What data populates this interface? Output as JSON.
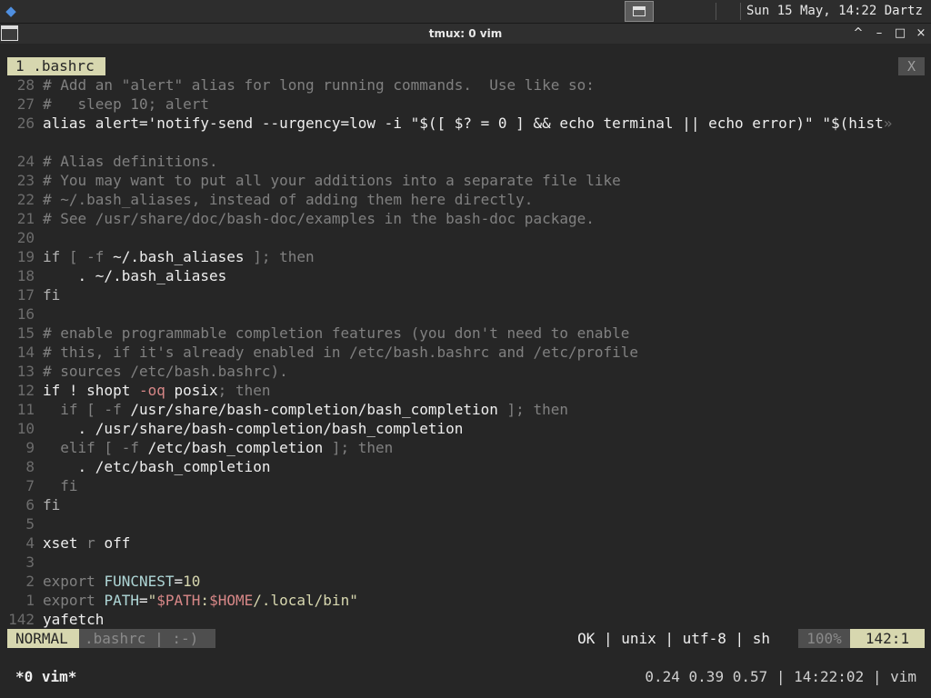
{
  "panel": {
    "menu_icon": "distro-menu-icon",
    "taskbar_icon": "window-icon",
    "clock": "Sun 15 May, 14:22",
    "user": "Dartz"
  },
  "window": {
    "title": "tmux: 0 vim",
    "minimize": "^",
    "maximize_restore": "–",
    "maximize": "□",
    "close": "×"
  },
  "vim": {
    "tab_label": "1 .bashrc",
    "tab_close": "X",
    "lines": [
      {
        "n": "28",
        "segments": [
          {
            "t": "# Add an \"alert\" alias for long running commands.  Use like so:",
            "c": "cm"
          }
        ]
      },
      {
        "n": "27",
        "segments": [
          {
            "t": "#   sleep 10; alert",
            "c": "cm"
          }
        ]
      },
      {
        "n": "26",
        "segments": [
          {
            "t": "alias alert=",
            "c": ""
          },
          {
            "t": "'notify-send --urgency=low -i \"$([ $? = 0 ] && echo terminal || echo error)\" \"$(hist",
            "c": ""
          },
          {
            "t": "»",
            "c": "ar"
          }
        ]
      },
      {
        "n": "",
        "segments": []
      },
      {
        "n": "24",
        "segments": [
          {
            "t": "# Alias definitions.",
            "c": "cm"
          }
        ]
      },
      {
        "n": "23",
        "segments": [
          {
            "t": "# You may want to put all your additions into a separate file like",
            "c": "cm"
          }
        ]
      },
      {
        "n": "22",
        "segments": [
          {
            "t": "# ~/.bash_aliases, instead of adding them here directly.",
            "c": "cm"
          }
        ]
      },
      {
        "n": "21",
        "segments": [
          {
            "t": "# See /usr/share/doc/bash-doc/examples in the bash-doc package.",
            "c": "cm"
          }
        ]
      },
      {
        "n": "20",
        "segments": []
      },
      {
        "n": "19",
        "segments": [
          {
            "t": "if",
            "c": "kw"
          },
          {
            "t": " [ ",
            "c": "cm"
          },
          {
            "t": "-f",
            "c": "cm"
          },
          {
            "t": " ~/.bash_aliases ",
            "c": ""
          },
          {
            "t": "]; then",
            "c": "cm"
          }
        ]
      },
      {
        "n": "18",
        "segments": [
          {
            "t": "    . ~/.bash_aliases",
            "c": ""
          }
        ]
      },
      {
        "n": "17",
        "segments": [
          {
            "t": "fi",
            "c": "kw"
          }
        ]
      },
      {
        "n": "16",
        "segments": []
      },
      {
        "n": "15",
        "segments": [
          {
            "t": "# enable programmable completion features (you don't need to enable",
            "c": "cm"
          }
        ]
      },
      {
        "n": "14",
        "segments": [
          {
            "t": "# this, if it's already enabled in /etc/bash.bashrc and /etc/profile",
            "c": "cm"
          }
        ]
      },
      {
        "n": "13",
        "segments": [
          {
            "t": "# sources /etc/bash.bashrc).",
            "c": "cm"
          }
        ]
      },
      {
        "n": "12",
        "segments": [
          {
            "t": "if ! ",
            "c": ""
          },
          {
            "t": "shopt",
            "c": ""
          },
          {
            "t": " -oq",
            "c": "op"
          },
          {
            "t": " posix",
            "c": ""
          },
          {
            "t": "; then",
            "c": "cm"
          }
        ]
      },
      {
        "n": "11",
        "segments": [
          {
            "t": "  if [ -f ",
            "c": "cm"
          },
          {
            "t": "/usr/share/bash-completion/bash_completion",
            "c": ""
          },
          {
            "t": " ]; then",
            "c": "cm"
          }
        ]
      },
      {
        "n": "10",
        "segments": [
          {
            "t": "    . /usr/share/bash-completion/bash_completion",
            "c": ""
          }
        ]
      },
      {
        "n": "9",
        "segments": [
          {
            "t": "  elif [ -f ",
            "c": "cm"
          },
          {
            "t": "/etc/bash_completion",
            "c": ""
          },
          {
            "t": " ]; then",
            "c": "cm"
          }
        ]
      },
      {
        "n": "8",
        "segments": [
          {
            "t": "    . /etc/bash_completion",
            "c": ""
          }
        ]
      },
      {
        "n": "7",
        "segments": [
          {
            "t": "  fi",
            "c": "cm"
          }
        ]
      },
      {
        "n": "6",
        "segments": [
          {
            "t": "fi",
            "c": "kw"
          }
        ]
      },
      {
        "n": "5",
        "segments": []
      },
      {
        "n": "4",
        "segments": [
          {
            "t": "xset",
            "c": ""
          },
          {
            "t": " r ",
            "c": "cm"
          },
          {
            "t": "off",
            "c": ""
          }
        ]
      },
      {
        "n": "3",
        "segments": []
      },
      {
        "n": "2",
        "segments": [
          {
            "t": "export ",
            "c": "cm"
          },
          {
            "t": "FUNCNEST",
            "c": "vr"
          },
          {
            "t": "=",
            "c": ""
          },
          {
            "t": "10",
            "c": "nm"
          }
        ]
      },
      {
        "n": "1",
        "segments": [
          {
            "t": "export ",
            "c": "cm"
          },
          {
            "t": "PATH",
            "c": "vr"
          },
          {
            "t": "=",
            "c": ""
          },
          {
            "t": "\"",
            "c": "st"
          },
          {
            "t": "$PATH",
            "c": "op"
          },
          {
            "t": ":",
            "c": "st"
          },
          {
            "t": "$HOME",
            "c": "op"
          },
          {
            "t": "/.local/bin\"",
            "c": "st"
          }
        ]
      },
      {
        "n": "142",
        "segments": [
          {
            "t": "yafetch",
            "c": ""
          }
        ]
      }
    ],
    "status": {
      "mode": "NORMAL",
      "file": ".bashrc | :-)",
      "right": "OK | unix | utf-8 | sh",
      "percent": "100%",
      "position": "142:1"
    }
  },
  "tmux": {
    "window": "*0 vim*",
    "status": "0.24 0.39 0.57 | 14:22:02 | vim"
  },
  "colors": {
    "background": "#262626",
    "accent": "#d7d7af",
    "comment": "#808080",
    "line_number": "#6c6c6c"
  }
}
